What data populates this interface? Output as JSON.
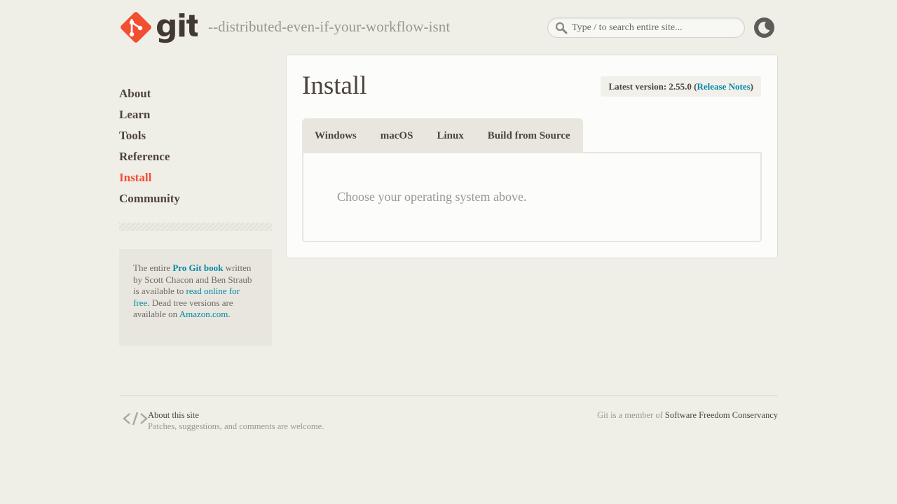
{
  "header": {
    "logo_text": "git",
    "tagline": "--distributed-even-if-your-workflow-isnt",
    "search_placeholder": "Type / to search entire site...",
    "search_value": ""
  },
  "sidebar": {
    "items": [
      {
        "label": "About",
        "active": false
      },
      {
        "label": "Learn",
        "active": false
      },
      {
        "label": "Tools",
        "active": false
      },
      {
        "label": "Reference",
        "active": false
      },
      {
        "label": "Install",
        "active": true
      },
      {
        "label": "Community",
        "active": false
      }
    ],
    "book": {
      "t1": "The entire ",
      "link1": "Pro Git book",
      "t2": " written by Scott Chacon and Ben Straub is available to ",
      "link2": "read online for free",
      "t3": ". Dead tree versions are available on ",
      "link3": "Amazon.com",
      "t4": "."
    }
  },
  "main": {
    "title": "Install",
    "version_prefix": "Latest version: 2.55.0 (",
    "release_notes": "Release Notes",
    "version_suffix": ")",
    "tabs": [
      {
        "label": "Windows"
      },
      {
        "label": "macOS"
      },
      {
        "label": "Linux"
      },
      {
        "label": "Build from Source"
      }
    ],
    "panel_text": "Choose your operating system above."
  },
  "footer": {
    "about_link": "About this site",
    "about_sub": "Patches, suggestions, and comments are welcome.",
    "member_prefix": "Git is a member of ",
    "member_link": "Software Freedom Conservancy"
  },
  "colors": {
    "accent": "#f14e32",
    "link": "#0388a6",
    "text": "#4e443c",
    "background": "#f0efe7"
  },
  "icons": {
    "logo": "git-logo-icon",
    "search": "search-icon",
    "theme": "moon-icon",
    "footer": "code-brackets-icon"
  }
}
